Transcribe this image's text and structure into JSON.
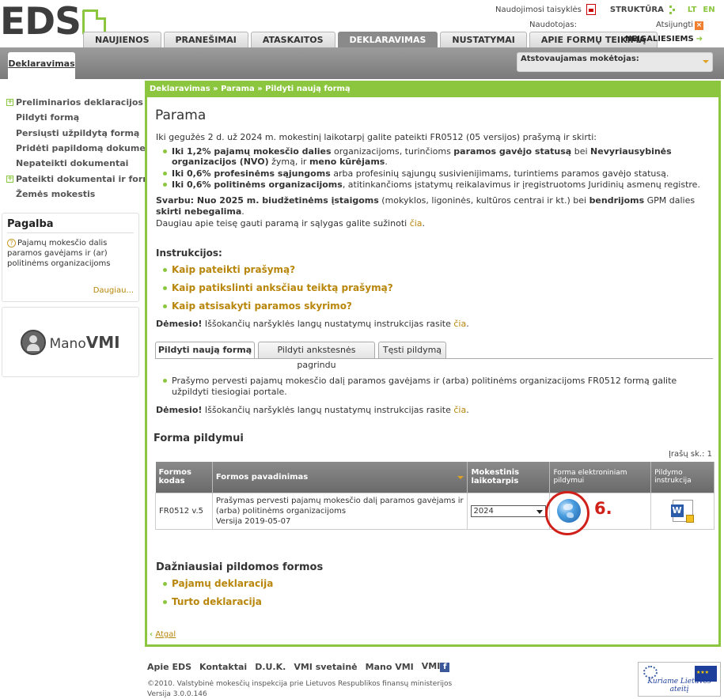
{
  "header": {
    "logo_text": "EDS",
    "rules_link": "Naudojimosi taisyklės",
    "structure_link": "STRUKTŪRA",
    "lang_lt": "LT",
    "lang_en": "EN",
    "user_label": "Naudotojas:",
    "logout": "Atsijungti",
    "disabled_link": "NEĮGALIESIEMS"
  },
  "main_tabs": [
    {
      "label": "NAUJIENOS",
      "active": false
    },
    {
      "label": "PRANEŠIMAI",
      "active": false
    },
    {
      "label": "ATASKAITOS",
      "active": false
    },
    {
      "label": "DEKLARAVIMAS",
      "active": true
    },
    {
      "label": "NUSTATYMAI",
      "active": false
    },
    {
      "label": "APIE FORMŲ TEIKIMĄ",
      "active": false
    }
  ],
  "subtab": "Deklaravimas",
  "payer_label": "Atstovaujamas mokėtojas:",
  "sidebar": {
    "items": [
      {
        "label": "Preliminarios deklaracijos",
        "expandable": true
      },
      {
        "label": "Pildyti formą",
        "expandable": false
      },
      {
        "label": "Persiųsti užpildytą formą",
        "expandable": false
      },
      {
        "label": "Pridėti papildomą dokumentą",
        "expandable": false
      },
      {
        "label": "Nepateikti dokumentai",
        "expandable": false
      },
      {
        "label": "Pateikti dokumentai ir formos",
        "expandable": true
      },
      {
        "label": "Žemės mokestis",
        "expandable": false
      }
    ]
  },
  "help": {
    "title": "Pagalba",
    "question": "Pajamų mokesčio dalis paramos gavėjams ir (ar) politinėms organizacijoms",
    "more": "Daugiau..."
  },
  "manovmi": {
    "mano": "Mano",
    "vmi": "VMI"
  },
  "breadcrumb": "Deklaravimas » Parama » Pildyti naują formą",
  "page": {
    "title": "Parama",
    "intro": "Iki gegužės 2 d. už 2024 m. mokestinį laikotarpį galite pateikti FR0512 (05 versijos) prašymą ir skirti:",
    "bullets": [
      {
        "b1": "Iki 1,2% pajamų mokesčio dalies",
        "t1": " organizacijoms, turinčioms ",
        "b2": "paramos gavėjo statusą",
        "t2": " bei ",
        "b3": "Nevyriausybinės organizacijos (NVO)",
        "t3": " žymą, ir ",
        "b4": "meno kūrėjams",
        "t4": "."
      },
      {
        "b1": "Iki 0,6% profesinėms sąjungoms",
        "t1": " arba profesinių sąjungų susivienijimams, turintiems paramos gavėjo statusą."
      },
      {
        "b1": "Iki 0,6% politinėms organizacijoms",
        "t1": ", atitinkančioms įstatymų reikalavimus ir įregistruotoms Juridinių asmenų registre."
      }
    ],
    "svarbu_b": "Svarbu: Nuo 2025 m. biudžetinėms įstaigoms",
    "svarbu_t": " (mokyklos, ligoninės, kultūros centrai ir kt.) bei ",
    "svarbu_b2": "bendrijoms",
    "svarbu_t2": " GPM dalies ",
    "svarbu_b3": "skirti nebegalima",
    "svarbu_end": ".",
    "more_text": "Daugiau apie teisę gauti paramą ir sąlygas galite sužinoti ",
    "more_link": "čia",
    "more_end": ".",
    "instr_title": "Instrukcijos:",
    "instr_links": [
      "Kaip pateikti prašymą?",
      "Kaip patikslinti anksčiau teiktą prašymą?",
      "Kaip atsisakyti paramos skyrimo?"
    ],
    "attention_b": "Dėmesio!",
    "attention_t": " Iššokančių naršyklės langų nustatymų instrukcijas rasite ",
    "attention_link": "čia",
    "attention_end": "."
  },
  "tabs2": [
    {
      "label": "Pildyti naują formą",
      "active": true
    },
    {
      "label": "Pildyti ankstesnės pagrindu",
      "active": false
    },
    {
      "label": "Tęsti pildymą",
      "active": false
    }
  ],
  "tabcontent": {
    "bullet": "Prašymo pervesti pajamų mokesčio dalį paramos gavėjams ir (arba) politinėms organizacijoms FR0512 formą galite užpildyti tiesiogiai portale.",
    "attention_b": "Dėmesio!",
    "attention_t": " Iššokančių naršyklės langų nustatymų instrukcijas rasite ",
    "attention_link": "čia",
    "attention_end": "."
  },
  "forms": {
    "title": "Forma pildymui",
    "count": "Įrašų sk.: 1",
    "headers": [
      "Formos kodas",
      "Formos pavadinimas",
      "Mokestinis laikotarpis",
      "Forma elektroniniam pildymui",
      "Pildymo instrukcija"
    ],
    "row": {
      "code": "FR0512 v.5",
      "name": "Prašymas pervesti pajamų mokesčio dalį paramos gavėjams ir (arba) politinėms organizacijoms",
      "version": "Versija 2019-05-07",
      "period": "2024"
    },
    "step_label": "6."
  },
  "frequent": {
    "title": "Dažniausiai pildomos formos",
    "items": [
      "Pajamų deklaracija",
      "Turto deklaracija"
    ]
  },
  "back": "Atgal",
  "footer": {
    "links": [
      "Apie EDS",
      "Kontaktai",
      "D.U.K.",
      "VMI svetainė",
      "Mano VMI",
      "VMI"
    ],
    "copyright": "©2010. Valstybinė mokesčių inspekcija prie Lietuvos Respublikos finansų ministerijos",
    "version": "Versija 3.0.0.146",
    "eu_slogan": "Kuriame Lietuvos ateitį"
  },
  "colors": {
    "accent": "#8cc63f",
    "link": "#b8860b",
    "highlight": "#d0201a"
  }
}
